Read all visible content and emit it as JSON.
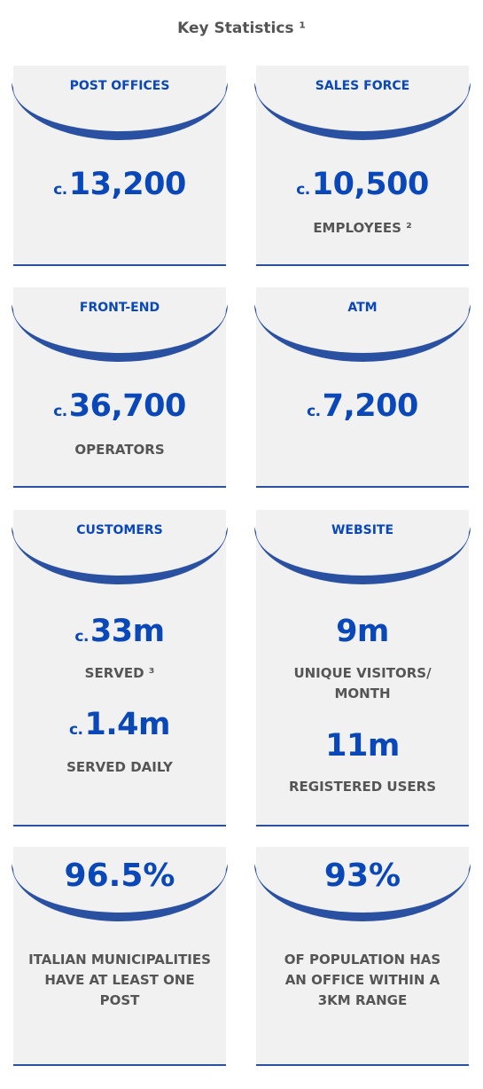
{
  "title": "Key Statistics ¹",
  "colors": {
    "accent": "#0a47b8",
    "arc": "#2a50a2",
    "card_bg": "#f1f1f1",
    "text_gray": "#555555"
  },
  "cards": [
    {
      "heading": "POST OFFICES",
      "prefix": "c.",
      "value": "13,200"
    },
    {
      "heading": "SALES FORCE",
      "prefix": "c.",
      "value": "10,500",
      "label": "EMPLOYEES ²"
    },
    {
      "heading": "FRONT-END",
      "prefix": "c.",
      "value": "36,700",
      "label": "OPERATORS"
    },
    {
      "heading": "ATM",
      "prefix": "c.",
      "value": "7,200"
    },
    {
      "heading": "CUSTOMERS",
      "prefix": "c.",
      "value": "33m",
      "label": "SERVED ³",
      "prefix2": "c.",
      "value2": "1.4m",
      "label2": "SERVED DAILY"
    },
    {
      "heading": "WEBSITE",
      "value": "9m",
      "label": "UNIQUE VISITORS/ MONTH",
      "value2": "11m",
      "label2": "REGISTERED USERS"
    },
    {
      "heading": "96.5%",
      "label": "ITALIAN MUNICIPALITIES HAVE AT LEAST ONE POST"
    },
    {
      "heading": "93%",
      "label": "OF POPULATION HAS AN OFFICE WITHIN A 3KM RANGE"
    }
  ]
}
